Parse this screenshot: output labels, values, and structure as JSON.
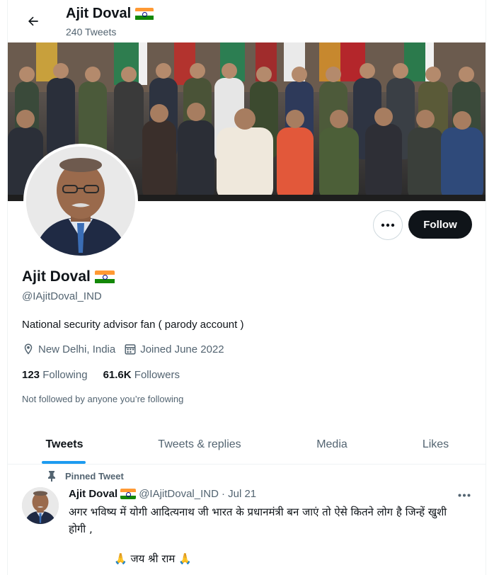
{
  "header": {
    "name": "Ajit Doval",
    "tweet_count": "240 Tweets"
  },
  "profile": {
    "name": "Ajit Doval",
    "handle": "@IAjitDoval_IND",
    "bio": "National security advisor fan ( parody account )",
    "location": "New Delhi, India",
    "joined": "Joined June 2022",
    "following_count": "123",
    "following_label": "Following",
    "followers_count": "61.6K",
    "followers_label": "Followers",
    "follow_note": "Not followed by anyone you’re following",
    "follow_button": "Follow"
  },
  "tabs": [
    {
      "label": "Tweets",
      "active": true
    },
    {
      "label": "Tweets & replies",
      "active": false
    },
    {
      "label": "Media",
      "active": false
    },
    {
      "label": "Likes",
      "active": false
    }
  ],
  "tweet": {
    "pinned_label": "Pinned Tweet",
    "author": "Ajit Doval",
    "handle": "@IAjitDoval_IND",
    "date": "· Jul 21",
    "text": "अगर भविष्य में योगी आदित्यनाथ जी भारत के प्रधानमंत्री बन जाएं तो ऐसे कितने लोग है जिन्हें खुशी होगी ,",
    "text2": "🙏 जय श्री राम 🙏"
  },
  "colors": {
    "accent": "#1d9bf0",
    "text_primary": "#0f1419",
    "text_secondary": "#536471",
    "follow_button_bg": "#0f1419"
  },
  "icons": [
    "back-arrow-icon",
    "india-flag-icon",
    "more-icon",
    "location-icon",
    "calendar-icon",
    "pin-icon"
  ]
}
